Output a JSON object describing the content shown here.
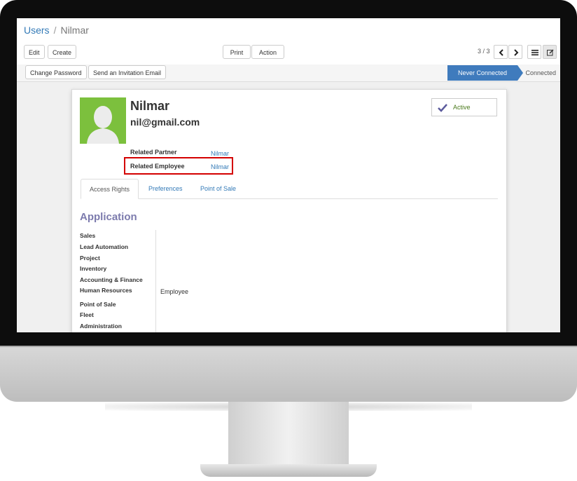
{
  "breadcrumb": {
    "parent": "Users",
    "separator": "/",
    "current": "Nilmar"
  },
  "buttons": {
    "edit": "Edit",
    "create": "Create",
    "print": "Print",
    "action": "Action"
  },
  "pager": {
    "value": "3 / 3"
  },
  "header_buttons": {
    "change_password": "Change Password",
    "send_invitation": "Send an Invitation Email"
  },
  "status": {
    "stage_current": "Never Connected",
    "stage_next": "Connected"
  },
  "user": {
    "name": "Nilmar",
    "email": "nil@gmail.com",
    "active_label": "Active"
  },
  "fields": {
    "related_partner_label": "Related Partner",
    "related_partner_value": "Nilmar",
    "related_employee_label": "Related Employee",
    "related_employee_value": "Nilmar"
  },
  "tabs": [
    "Access Rights",
    "Preferences",
    "Point of Sale"
  ],
  "application": {
    "title": "Application",
    "items": [
      "Sales",
      "Lead Automation",
      "Project",
      "Inventory",
      "Accounting & Finance",
      "Human Resources",
      "Point of Sale",
      "Fleet",
      "Administration"
    ],
    "human_resources_value": "Employee"
  },
  "colors": {
    "accent": "#337ab7",
    "stage": "#3f7bbd",
    "highlight": "#d40000",
    "avatar_bg": "#7cc03d",
    "title": "#7c7bad"
  },
  "icons": [
    "chevron-left-icon",
    "chevron-right-icon",
    "list-view-icon",
    "form-view-icon",
    "check-icon",
    "user-avatar-icon"
  ]
}
